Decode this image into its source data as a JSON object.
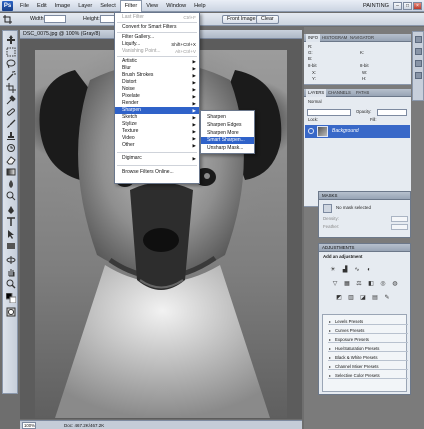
{
  "menubar": {
    "items": [
      "File",
      "Edit",
      "Image",
      "Layer",
      "Select",
      "Filter",
      "View",
      "Window",
      "Help"
    ],
    "active": "Filter",
    "workspace": "PAINTING"
  },
  "options": {
    "width_label": "Width:",
    "height_label": "Height:",
    "front_image": "Front Image",
    "clear": "Clear"
  },
  "document": {
    "tab_title": "DSC_0075.jpg @ 100% (Gray/8)",
    "tab_close": "×"
  },
  "filter_menu": {
    "items": [
      {
        "label": "Last Filter",
        "shortcut": "Ctrl+F",
        "disabled": true
      },
      {
        "label": "Convert for Smart Filters"
      },
      {
        "label": "Filter Gallery..."
      },
      {
        "label": "Liquify...",
        "shortcut": "Shift+Ctrl+X"
      },
      {
        "label": "Vanishing Point...",
        "shortcut": "Alt+Ctrl+V",
        "disabled": true
      },
      {
        "label": "Artistic",
        "submenu": true
      },
      {
        "label": "Blur",
        "submenu": true
      },
      {
        "label": "Brush Strokes",
        "submenu": true
      },
      {
        "label": "Distort",
        "submenu": true
      },
      {
        "label": "Noise",
        "submenu": true
      },
      {
        "label": "Pixelate",
        "submenu": true
      },
      {
        "label": "Render",
        "submenu": true
      },
      {
        "label": "Sharpen",
        "submenu": true,
        "highlighted": true
      },
      {
        "label": "Sketch",
        "submenu": true
      },
      {
        "label": "Stylize",
        "submenu": true
      },
      {
        "label": "Texture",
        "submenu": true
      },
      {
        "label": "Video",
        "submenu": true
      },
      {
        "label": "Other",
        "submenu": true
      },
      {
        "label": "Digimarc",
        "submenu": true
      },
      {
        "label": "Browse Filters Online..."
      }
    ]
  },
  "sharpen_submenu": {
    "items": [
      "Sharpen",
      "Sharpen Edges",
      "Sharpen More",
      "Smart Sharpen...",
      "Unsharp Mask..."
    ],
    "highlighted": "Smart Sharpen..."
  },
  "info_panel": {
    "tabs": [
      "INFO",
      "HISTOGRAM",
      "NAVIGATOR"
    ],
    "r": "R:",
    "g": "G:",
    "b": "B:",
    "k": "K:",
    "bit_left": "8-bit",
    "bit_right": "8-bit",
    "x": "X:",
    "y": "Y:",
    "w": "W:",
    "h": "H:"
  },
  "layers_panel": {
    "tabs": [
      "LAYERS",
      "CHANNELS",
      "PATHS"
    ],
    "blend_mode": "Normal",
    "opacity_label": "Opacity:",
    "lock_label": "Lock:",
    "fill_label": "Fill:",
    "layer_name": "Background"
  },
  "masks_panel": {
    "title": "MASKS",
    "no_mask": "No mask selected",
    "density": "Density:",
    "feather": "Feather:"
  },
  "adjustments_panel": {
    "title": "ADJUSTMENTS",
    "heading": "Add an adjustment",
    "presets": [
      "Levels Presets",
      "Curves Presets",
      "Exposure Presets",
      "Hue/Saturation Presets",
      "Black & White Presets",
      "Channel Mixer Presets",
      "Selective Color Presets"
    ]
  },
  "statusbar": {
    "zoom": "100%",
    "doc_size": "Doc: 467.2K/467.2K"
  },
  "colors": {
    "highlight": "#2f62c9",
    "layer_selected": "#3868c8",
    "chrome": "#ccd4df"
  }
}
